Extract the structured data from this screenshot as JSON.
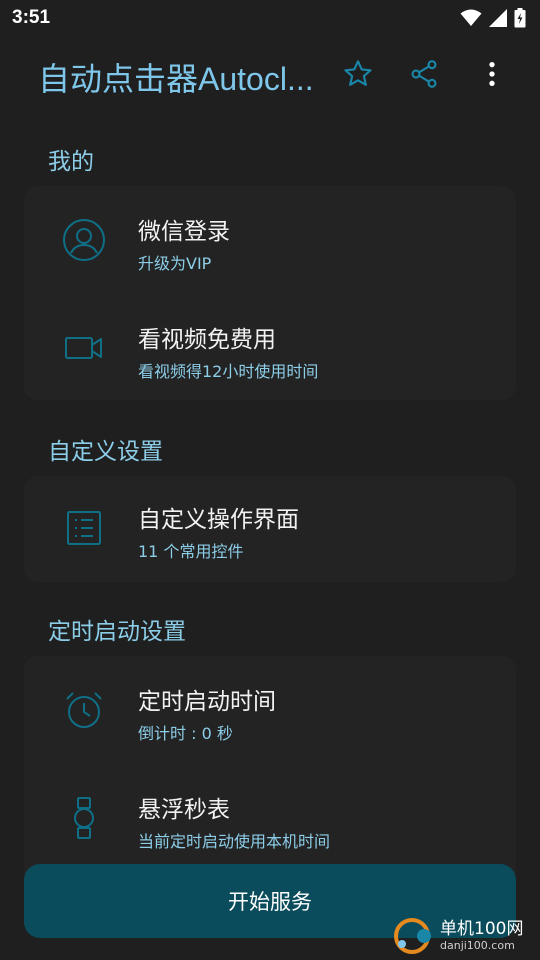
{
  "status_bar": {
    "time": "3:51",
    "icons": [
      "wifi-icon",
      "signal-icon",
      "battery-charging-icon"
    ]
  },
  "app_bar": {
    "title": "自动点击器Autocl...",
    "actions": [
      "star-icon",
      "share-icon",
      "more-vert-icon"
    ]
  },
  "sections": {
    "mine": {
      "header": "我的",
      "items": [
        {
          "title": "微信登录",
          "subtitle": "升级为VIP",
          "icon": "account-circle-icon"
        },
        {
          "title": "看视频免费用",
          "subtitle": "看视频得12小时使用时间",
          "icon": "video-camera-icon"
        }
      ]
    },
    "custom": {
      "header": "自定义设置",
      "items": [
        {
          "title": "自定义操作界面",
          "subtitle": "11 个常用控件",
          "icon": "list-icon"
        }
      ]
    },
    "timer": {
      "header": "定时启动设置",
      "items": [
        {
          "title": "定时启动时间",
          "subtitle": "倒计时 : 0 秒",
          "icon": "alarm-clock-icon"
        },
        {
          "title": "悬浮秒表",
          "subtitle": "当前定时启动使用本机时间",
          "icon": "watch-icon"
        }
      ]
    }
  },
  "start_button": {
    "label": "开始服务"
  },
  "watermark": {
    "name": "单机100网",
    "url": "danji100.com"
  },
  "colors": {
    "accent": "#7fc7ea",
    "icon": "#0f6f87",
    "background": "#1f1f1f",
    "card": "#232323",
    "button": "#0b4c5c"
  }
}
